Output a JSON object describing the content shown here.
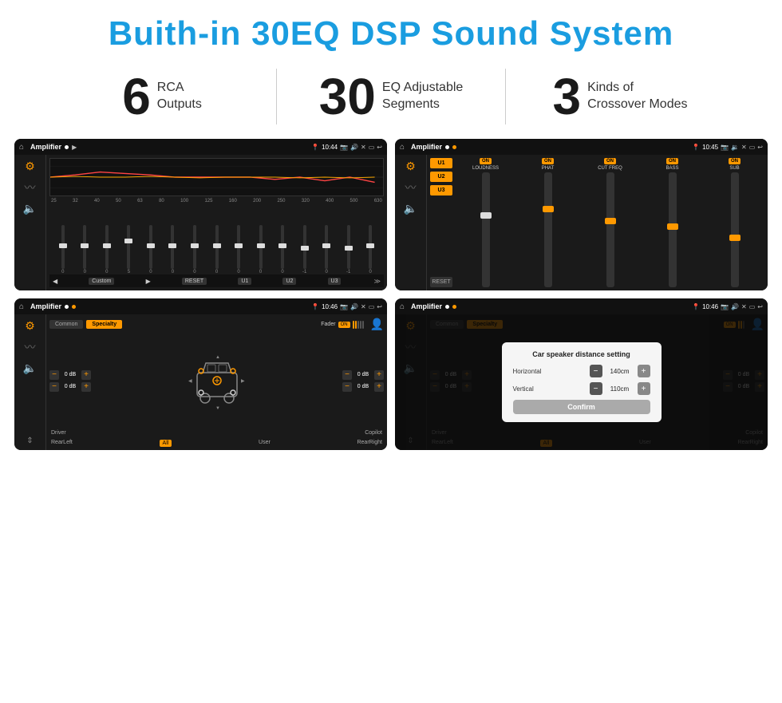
{
  "header": {
    "title": "Buith-in 30EQ DSP Sound System"
  },
  "stats": [
    {
      "number": "6",
      "text_line1": "RCA",
      "text_line2": "Outputs"
    },
    {
      "number": "30",
      "text_line1": "EQ Adjustable",
      "text_line2": "Segments"
    },
    {
      "number": "3",
      "text_line1": "Kinds of",
      "text_line2": "Crossover Modes"
    }
  ],
  "screens": [
    {
      "id": "screen1",
      "status_bar": {
        "title": "Amplifier",
        "time": "10:44"
      },
      "eq_freqs": [
        "25",
        "32",
        "40",
        "50",
        "63",
        "80",
        "100",
        "125",
        "160",
        "200",
        "250",
        "320",
        "400",
        "500",
        "630"
      ],
      "eq_values": [
        "0",
        "0",
        "0",
        "5",
        "0",
        "0",
        "0",
        "0",
        "0",
        "0",
        "0",
        "-1",
        "0",
        "-1"
      ],
      "bottom_btns": [
        "Custom",
        "RESET",
        "U1",
        "U2",
        "U3"
      ]
    },
    {
      "id": "screen2",
      "status_bar": {
        "title": "Amplifier",
        "time": "10:45"
      },
      "presets": [
        "U1",
        "U2",
        "U3"
      ],
      "controls": [
        "LOUDNESS",
        "PHAT",
        "CUT FREQ",
        "BASS",
        "SUB"
      ]
    },
    {
      "id": "screen3",
      "status_bar": {
        "title": "Amplifier",
        "time": "10:46"
      },
      "tabs": [
        "Common",
        "Specialty"
      ],
      "fader_label": "Fader",
      "on_label": "ON",
      "db_rows_left": [
        "0 dB",
        "0 dB"
      ],
      "db_rows_right": [
        "0 dB",
        "0 dB"
      ],
      "bottom_labels": [
        "Driver",
        "",
        "Copilot",
        "RearLeft",
        "All",
        "User",
        "RearRight"
      ]
    },
    {
      "id": "screen4",
      "status_bar": {
        "title": "Amplifier",
        "time": "10:46"
      },
      "tabs": [
        "Common",
        "Specialty"
      ],
      "on_label": "ON",
      "dialog": {
        "title": "Car speaker distance setting",
        "horizontal_label": "Horizontal",
        "horizontal_value": "140cm",
        "vertical_label": "Vertical",
        "vertical_value": "110cm",
        "confirm_label": "Confirm"
      },
      "db_rows_right": [
        "0 dB",
        "0 dB"
      ],
      "bottom_labels": [
        "Driver",
        "",
        "Copilot",
        "RearLeft",
        "All",
        "User",
        "RearRight"
      ]
    }
  ]
}
